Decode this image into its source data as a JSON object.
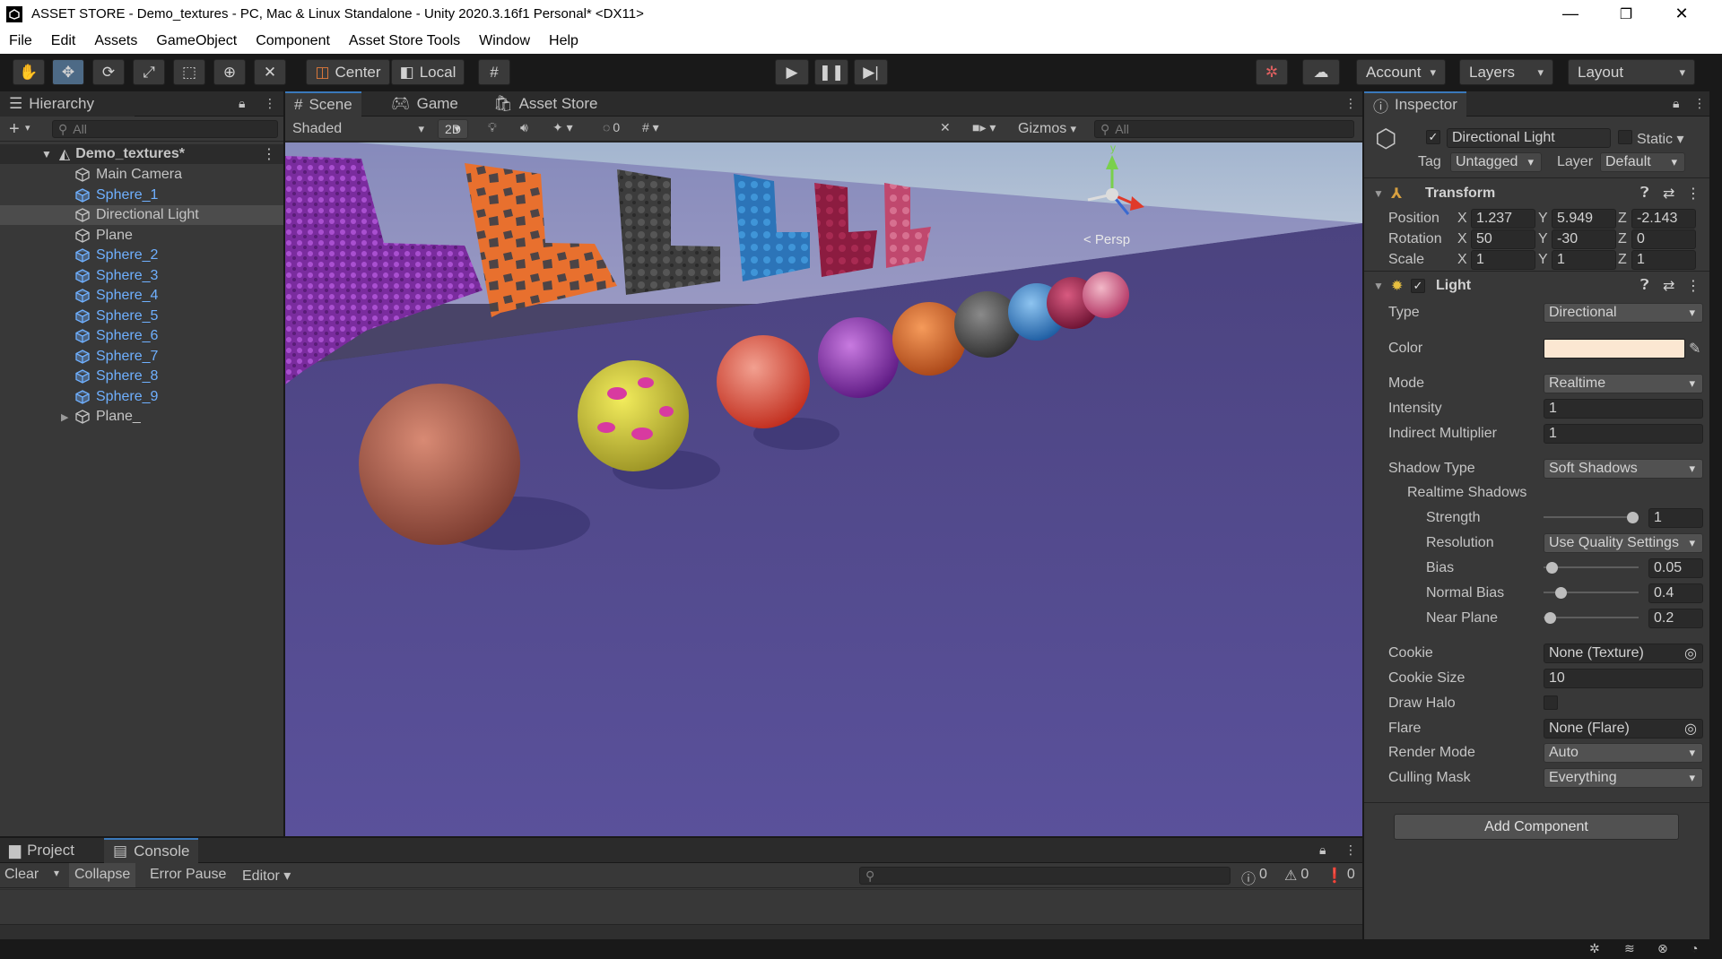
{
  "window": {
    "title": "ASSET STORE - Demo_textures - PC, Mac & Linux Standalone - Unity 2020.3.16f1 Personal* <DX11>",
    "minimize_glyph": "—",
    "maximize_glyph": "❐",
    "close_glyph": "✕"
  },
  "menu": [
    "File",
    "Edit",
    "Assets",
    "GameObject",
    "Component",
    "Asset Store Tools",
    "Window",
    "Help"
  ],
  "toolbar": {
    "pivot_label": "Center",
    "space_label": "Local",
    "account_label": "Account",
    "layers_label": "Layers",
    "layout_label": "Layout"
  },
  "hierarchy": {
    "tab_label": "Hierarchy",
    "search_placeholder": "All",
    "scene_name": "Demo_textures*",
    "items": [
      {
        "name": "Main Camera",
        "prefab": false
      },
      {
        "name": "Sphere_1",
        "prefab": true
      },
      {
        "name": "Directional Light",
        "prefab": false,
        "selected": true
      },
      {
        "name": "Plane",
        "prefab": false
      },
      {
        "name": "Sphere_2",
        "prefab": true
      },
      {
        "name": "Sphere_3",
        "prefab": true
      },
      {
        "name": "Sphere_4",
        "prefab": true
      },
      {
        "name": "Sphere_5",
        "prefab": true
      },
      {
        "name": "Sphere_6",
        "prefab": true
      },
      {
        "name": "Sphere_7",
        "prefab": true
      },
      {
        "name": "Sphere_8",
        "prefab": true
      },
      {
        "name": "Sphere_9",
        "prefab": true
      },
      {
        "name": "Plane_",
        "prefab": false,
        "expandable": true
      }
    ]
  },
  "scene_view": {
    "tabs": [
      "Scene",
      "Game",
      "Asset Store"
    ],
    "shading_mode": "Shaded",
    "mode_2d": "2D",
    "hidden_count": "0",
    "gizmos_label": "Gizmos",
    "search_placeholder": "All",
    "persp_label": "< Persp",
    "gizmo_axis": "y"
  },
  "bottom": {
    "tabs": [
      "Project",
      "Console"
    ],
    "clear": "Clear",
    "collapse": "Collapse",
    "error_pause": "Error Pause",
    "editor": "Editor",
    "log_count": "0",
    "warn_count": "0",
    "error_count": "0"
  },
  "inspector": {
    "tab_label": "Inspector",
    "object_name": "Directional Light",
    "static_label": "Static",
    "tag_label": "Tag",
    "tag_value": "Untagged",
    "layer_label": "Layer",
    "layer_value": "Default",
    "transform": {
      "title": "Transform",
      "position_label": "Position",
      "rotation_label": "Rotation",
      "scale_label": "Scale",
      "position": {
        "x": "1.237",
        "y": "5.949",
        "z": "-2.143"
      },
      "rotation": {
        "x": "50",
        "y": "-30",
        "z": "0"
      },
      "scale": {
        "x": "1",
        "y": "1",
        "z": "1"
      }
    },
    "light": {
      "title": "Light",
      "type_label": "Type",
      "type_value": "Directional",
      "color_label": "Color",
      "color_value": "#fbe7d2",
      "mode_label": "Mode",
      "mode_value": "Realtime",
      "intensity_label": "Intensity",
      "intensity_value": "1",
      "indirect_label": "Indirect Multiplier",
      "indirect_value": "1",
      "shadow_type_label": "Shadow Type",
      "shadow_type_value": "Soft Shadows",
      "realtime_shadows_label": "Realtime Shadows",
      "strength_label": "Strength",
      "strength_value": "1",
      "resolution_label": "Resolution",
      "resolution_value": "Use Quality Settings",
      "bias_label": "Bias",
      "bias_value": "0.05",
      "normal_bias_label": "Normal Bias",
      "normal_bias_value": "0.4",
      "near_plane_label": "Near Plane",
      "near_plane_value": "0.2",
      "cookie_label": "Cookie",
      "cookie_value": "None (Texture)",
      "cookie_size_label": "Cookie Size",
      "cookie_size_value": "10",
      "draw_halo_label": "Draw Halo",
      "flare_label": "Flare",
      "flare_value": "None (Flare)",
      "render_mode_label": "Render Mode",
      "render_mode_value": "Auto",
      "culling_mask_label": "Culling Mask",
      "culling_mask_value": "Everything"
    },
    "add_component": "Add Component"
  },
  "colors": {
    "accent": "#3a79bb",
    "prefab_blue": "#6fb0ff",
    "ground": "#544b94"
  }
}
